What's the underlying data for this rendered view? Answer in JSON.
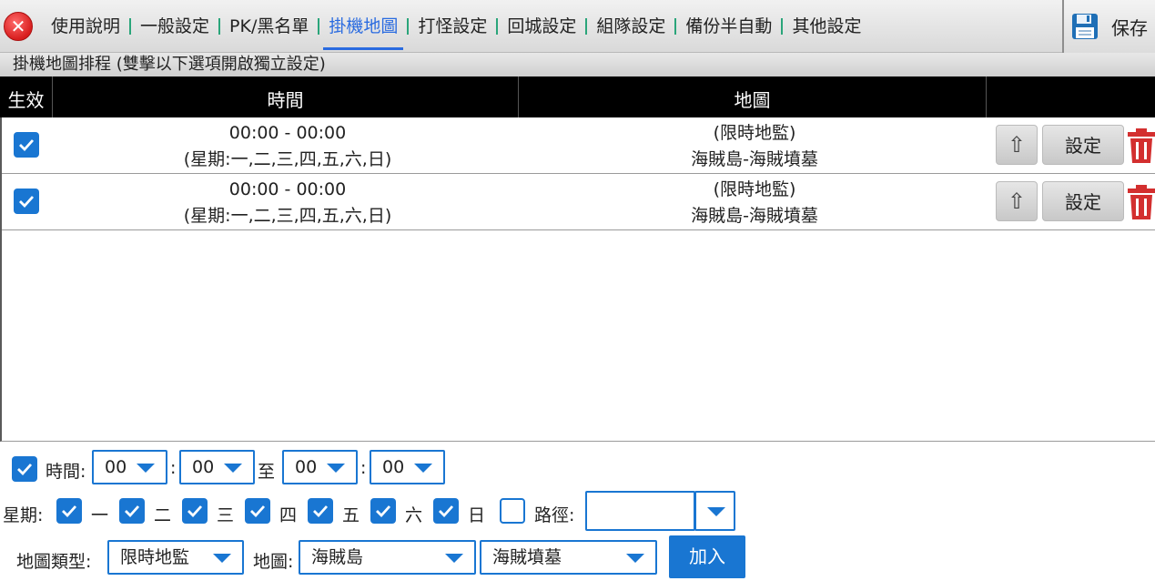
{
  "tabs": [
    {
      "label": "使用說明",
      "active": false
    },
    {
      "label": "一般設定",
      "active": false
    },
    {
      "label": "PK/黑名單",
      "active": false
    },
    {
      "label": "掛機地圖",
      "active": true
    },
    {
      "label": "打怪設定",
      "active": false
    },
    {
      "label": "回城設定",
      "active": false
    },
    {
      "label": "組隊設定",
      "active": false
    },
    {
      "label": "備份半自動",
      "active": false
    },
    {
      "label": "其他設定",
      "active": false
    }
  ],
  "save": {
    "label": "保存",
    "icon": "floppy-disk-icon"
  },
  "close": {
    "icon": "close-icon",
    "color": "#d81e1e"
  },
  "section_title": "掛機地圖排程 (雙擊以下選項開啟獨立設定)",
  "table": {
    "headers": {
      "enabled": "生效",
      "time": "時間",
      "map": "地圖",
      "actions": ""
    },
    "rows": [
      {
        "enabled": true,
        "time": "00:00 - 00:00",
        "days": "(星期:一,二,三,四,五,六,日)",
        "map_type": "(限時地監)",
        "map": "海賊島-海賊墳墓",
        "up_label": "⇧",
        "set_label": "設定"
      },
      {
        "enabled": true,
        "time": "00:00 - 00:00",
        "days": "(星期:一,二,三,四,五,六,日)",
        "map_type": "(限時地監)",
        "map": "海賊島-海賊墳墓",
        "up_label": "⇧",
        "set_label": "設定"
      }
    ]
  },
  "form": {
    "time_enabled": true,
    "time_label": "時間:",
    "start_hour": "00",
    "colon1": ":",
    "start_min": "00",
    "to_label": "至",
    "end_hour": "00",
    "colon2": ":",
    "end_min": "00",
    "week_label": "星期:",
    "days": [
      {
        "label": "一",
        "checked": true
      },
      {
        "label": "二",
        "checked": true
      },
      {
        "label": "三",
        "checked": true
      },
      {
        "label": "四",
        "checked": true
      },
      {
        "label": "五",
        "checked": true
      },
      {
        "label": "六",
        "checked": true
      },
      {
        "label": "日",
        "checked": true
      }
    ],
    "path_enabled": false,
    "path_label": "路徑:",
    "path_value": "",
    "map_type_label": "地圖類型:",
    "map_type_value": "限時地監",
    "map_label": "地圖:",
    "map_value": "海賊島",
    "submap_value": "海賊墳墓",
    "add_label": "加入"
  },
  "colors": {
    "accent": "#1976d2",
    "active_tab": "#2a6be0",
    "header_bg": "#000000",
    "delete": "#d32f2f"
  }
}
